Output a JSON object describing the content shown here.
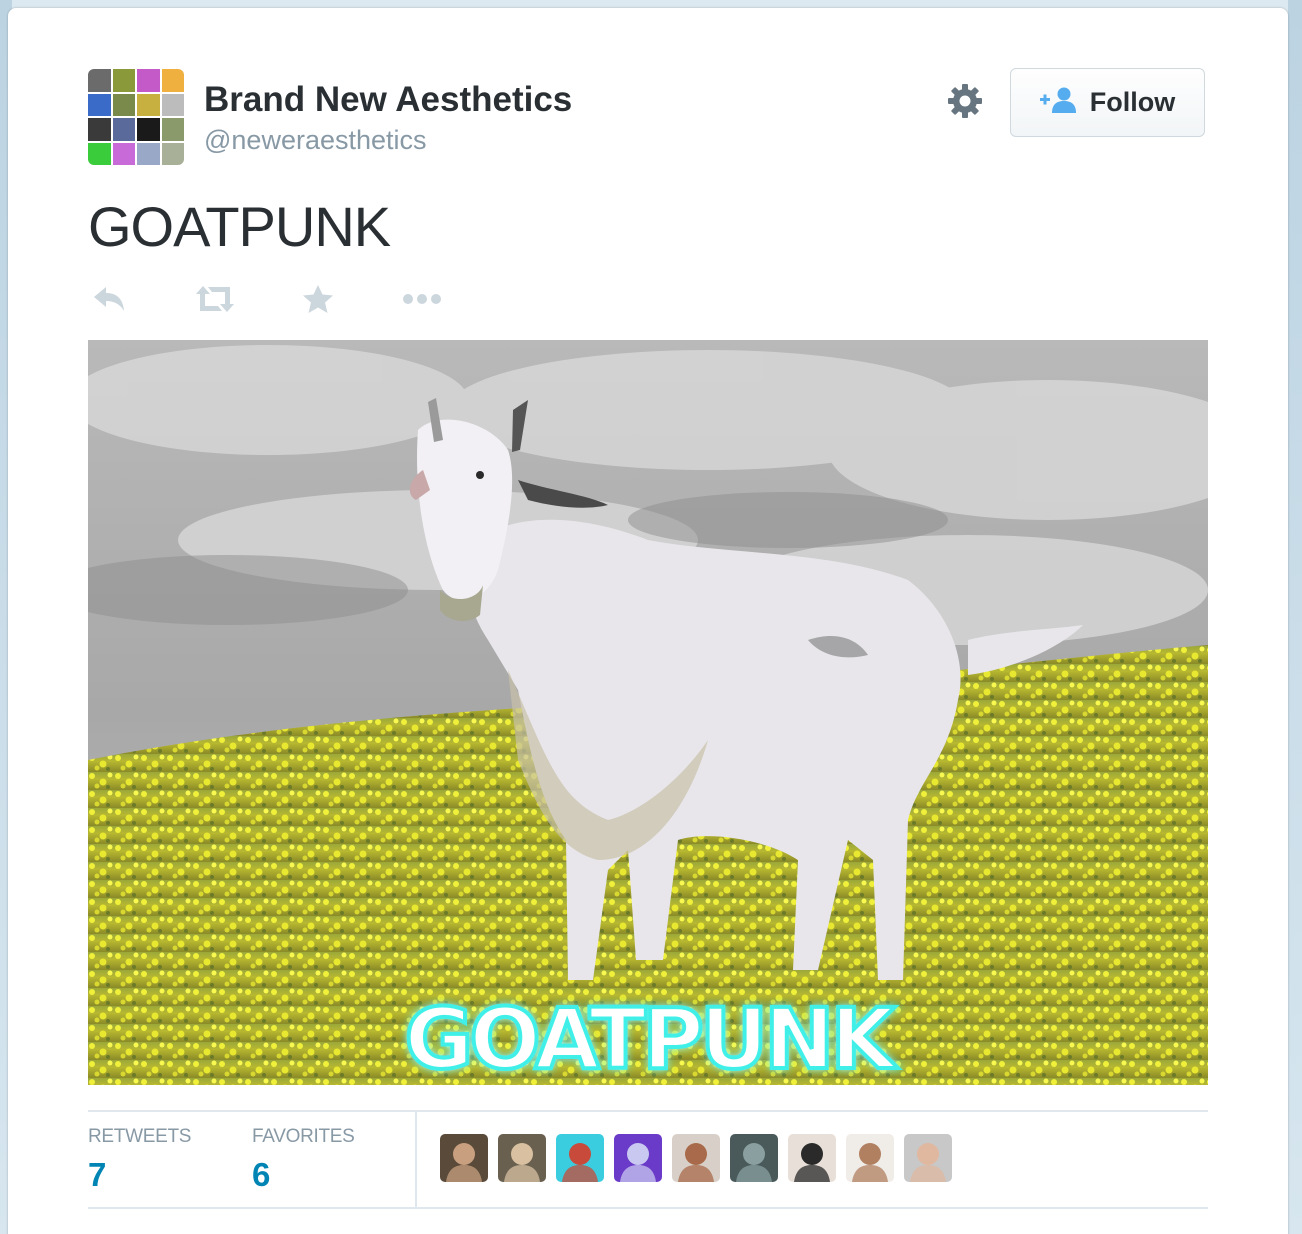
{
  "user": {
    "display_name": "Brand New Aesthetics",
    "screen_name": "@neweraesthetics",
    "avatar_tiles": [
      "#6b6b6b",
      "#8a9a3a",
      "#c45ac8",
      "#f0b040",
      "#3a6bc8",
      "#7a8a4a",
      "#c8b040",
      "#bcbcbc",
      "#3a3a3a",
      "#5a6a9a",
      "#1a1a1a",
      "#8a9a6a",
      "#3acc3a",
      "#c86ad8",
      "#9aa8c8",
      "#a8b098"
    ]
  },
  "follow_button": {
    "label": "Follow",
    "icon": "follow-user-icon"
  },
  "settings": {
    "icon": "gear-icon"
  },
  "tweet": {
    "text": "GOATPUNK",
    "media_caption": "GOATPUNK"
  },
  "actions": [
    {
      "name": "reply",
      "icon": "reply-icon"
    },
    {
      "name": "retweet",
      "icon": "retweet-icon"
    },
    {
      "name": "favorite",
      "icon": "star-icon"
    },
    {
      "name": "more",
      "icon": "more-dots-icon"
    }
  ],
  "stats": {
    "retweets_label": "RETWEETS",
    "retweets_count": "7",
    "favorites_label": "FAVORITES",
    "favorites_count": "6"
  },
  "favoriter_avatars": [
    {
      "bg": "#5a4a3a",
      "fg": "#c8a080"
    },
    {
      "bg": "#6a6050",
      "fg": "#d8c0a0"
    },
    {
      "bg": "#3acde0",
      "fg": "#c84a3a"
    },
    {
      "bg": "#6a3ac8",
      "fg": "#c8c8f0"
    },
    {
      "bg": "#d8d0c8",
      "fg": "#a86a4a"
    },
    {
      "bg": "#4a5a5a",
      "fg": "#8aa0a0"
    },
    {
      "bg": "#e8e0d8",
      "fg": "#2a2a2a"
    },
    {
      "bg": "#f0ece8",
      "fg": "#b08060"
    },
    {
      "bg": "#c8c8c8",
      "fg": "#e0b8a0"
    }
  ],
  "colors": {
    "accent": "#0084b4",
    "muted": "#8899a6",
    "text": "#292f33",
    "follow_icon": "#55acee"
  }
}
